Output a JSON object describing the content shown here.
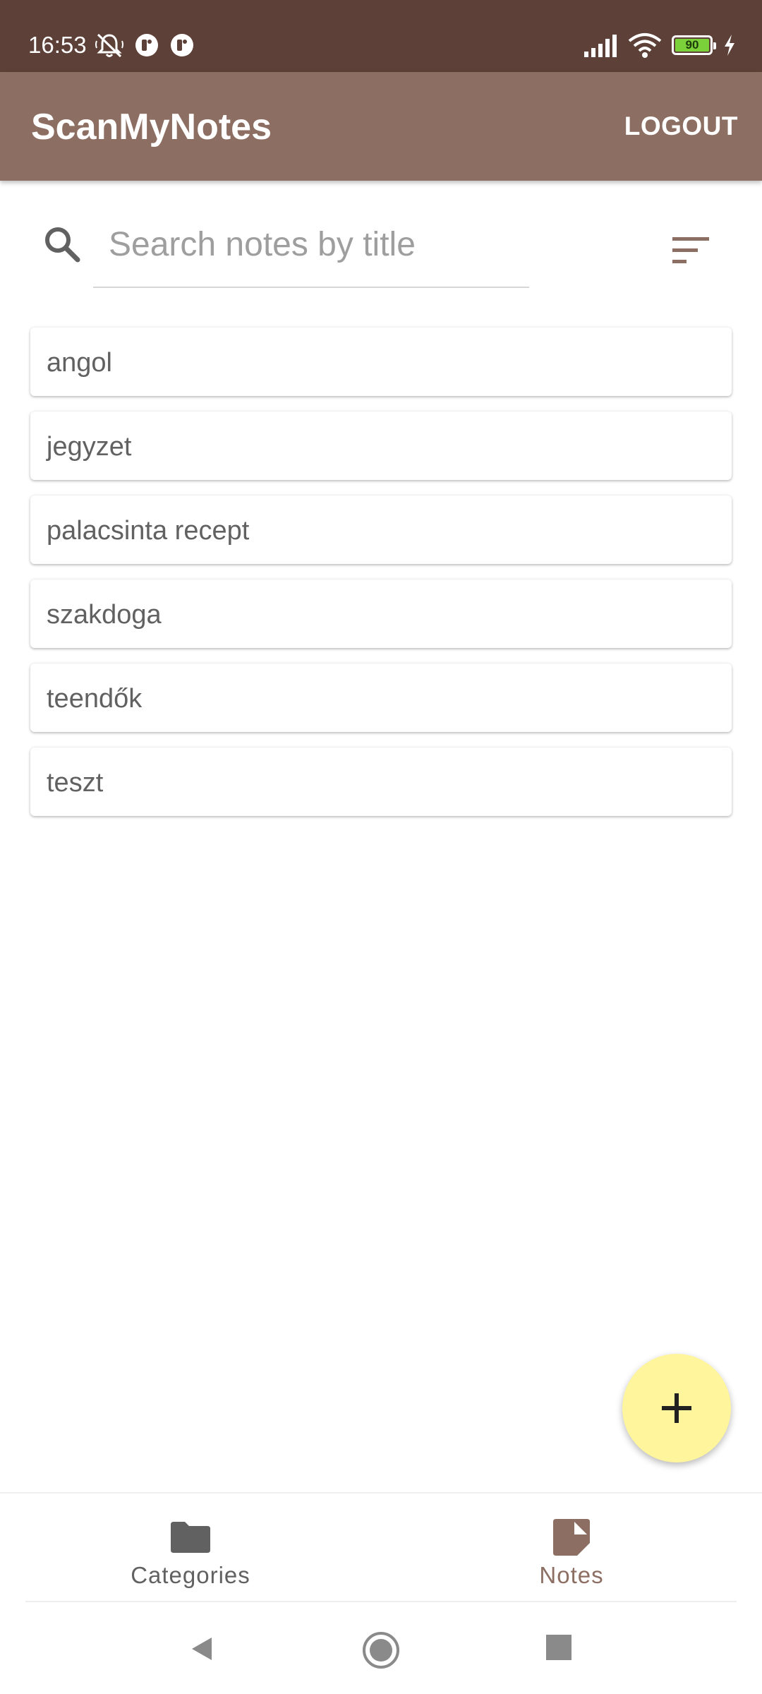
{
  "status_bar": {
    "time": "16:53",
    "battery_level": "90",
    "icons": [
      "muted-bell-icon",
      "app-notification-icon",
      "app-notification-icon",
      "signal-icon",
      "wifi-icon",
      "battery-icon",
      "charging-icon"
    ]
  },
  "app_bar": {
    "title": "ScanMyNotes",
    "logout_label": "LOGOUT",
    "background_color": "#8d6e63",
    "status_bar_color": "#5d4037"
  },
  "search": {
    "placeholder": "Search notes by title",
    "value": "",
    "icon": "search-icon",
    "sort_icon": "sort-icon"
  },
  "notes": [
    {
      "title": "angol"
    },
    {
      "title": "jegyzet"
    },
    {
      "title": "palacsinta recept"
    },
    {
      "title": "szakdoga"
    },
    {
      "title": "teendők"
    },
    {
      "title": "teszt"
    }
  ],
  "fab": {
    "icon": "add-icon",
    "color": "#fff59d"
  },
  "bottom_nav": {
    "items": [
      {
        "label": "Categories",
        "icon": "folder-icon",
        "selected": false
      },
      {
        "label": "Notes",
        "icon": "note-icon",
        "selected": true
      }
    ],
    "active_color": "#8d6e63",
    "inactive_color": "#616161"
  },
  "system_nav": {
    "buttons": [
      "back-icon",
      "home-icon",
      "recents-icon"
    ]
  }
}
